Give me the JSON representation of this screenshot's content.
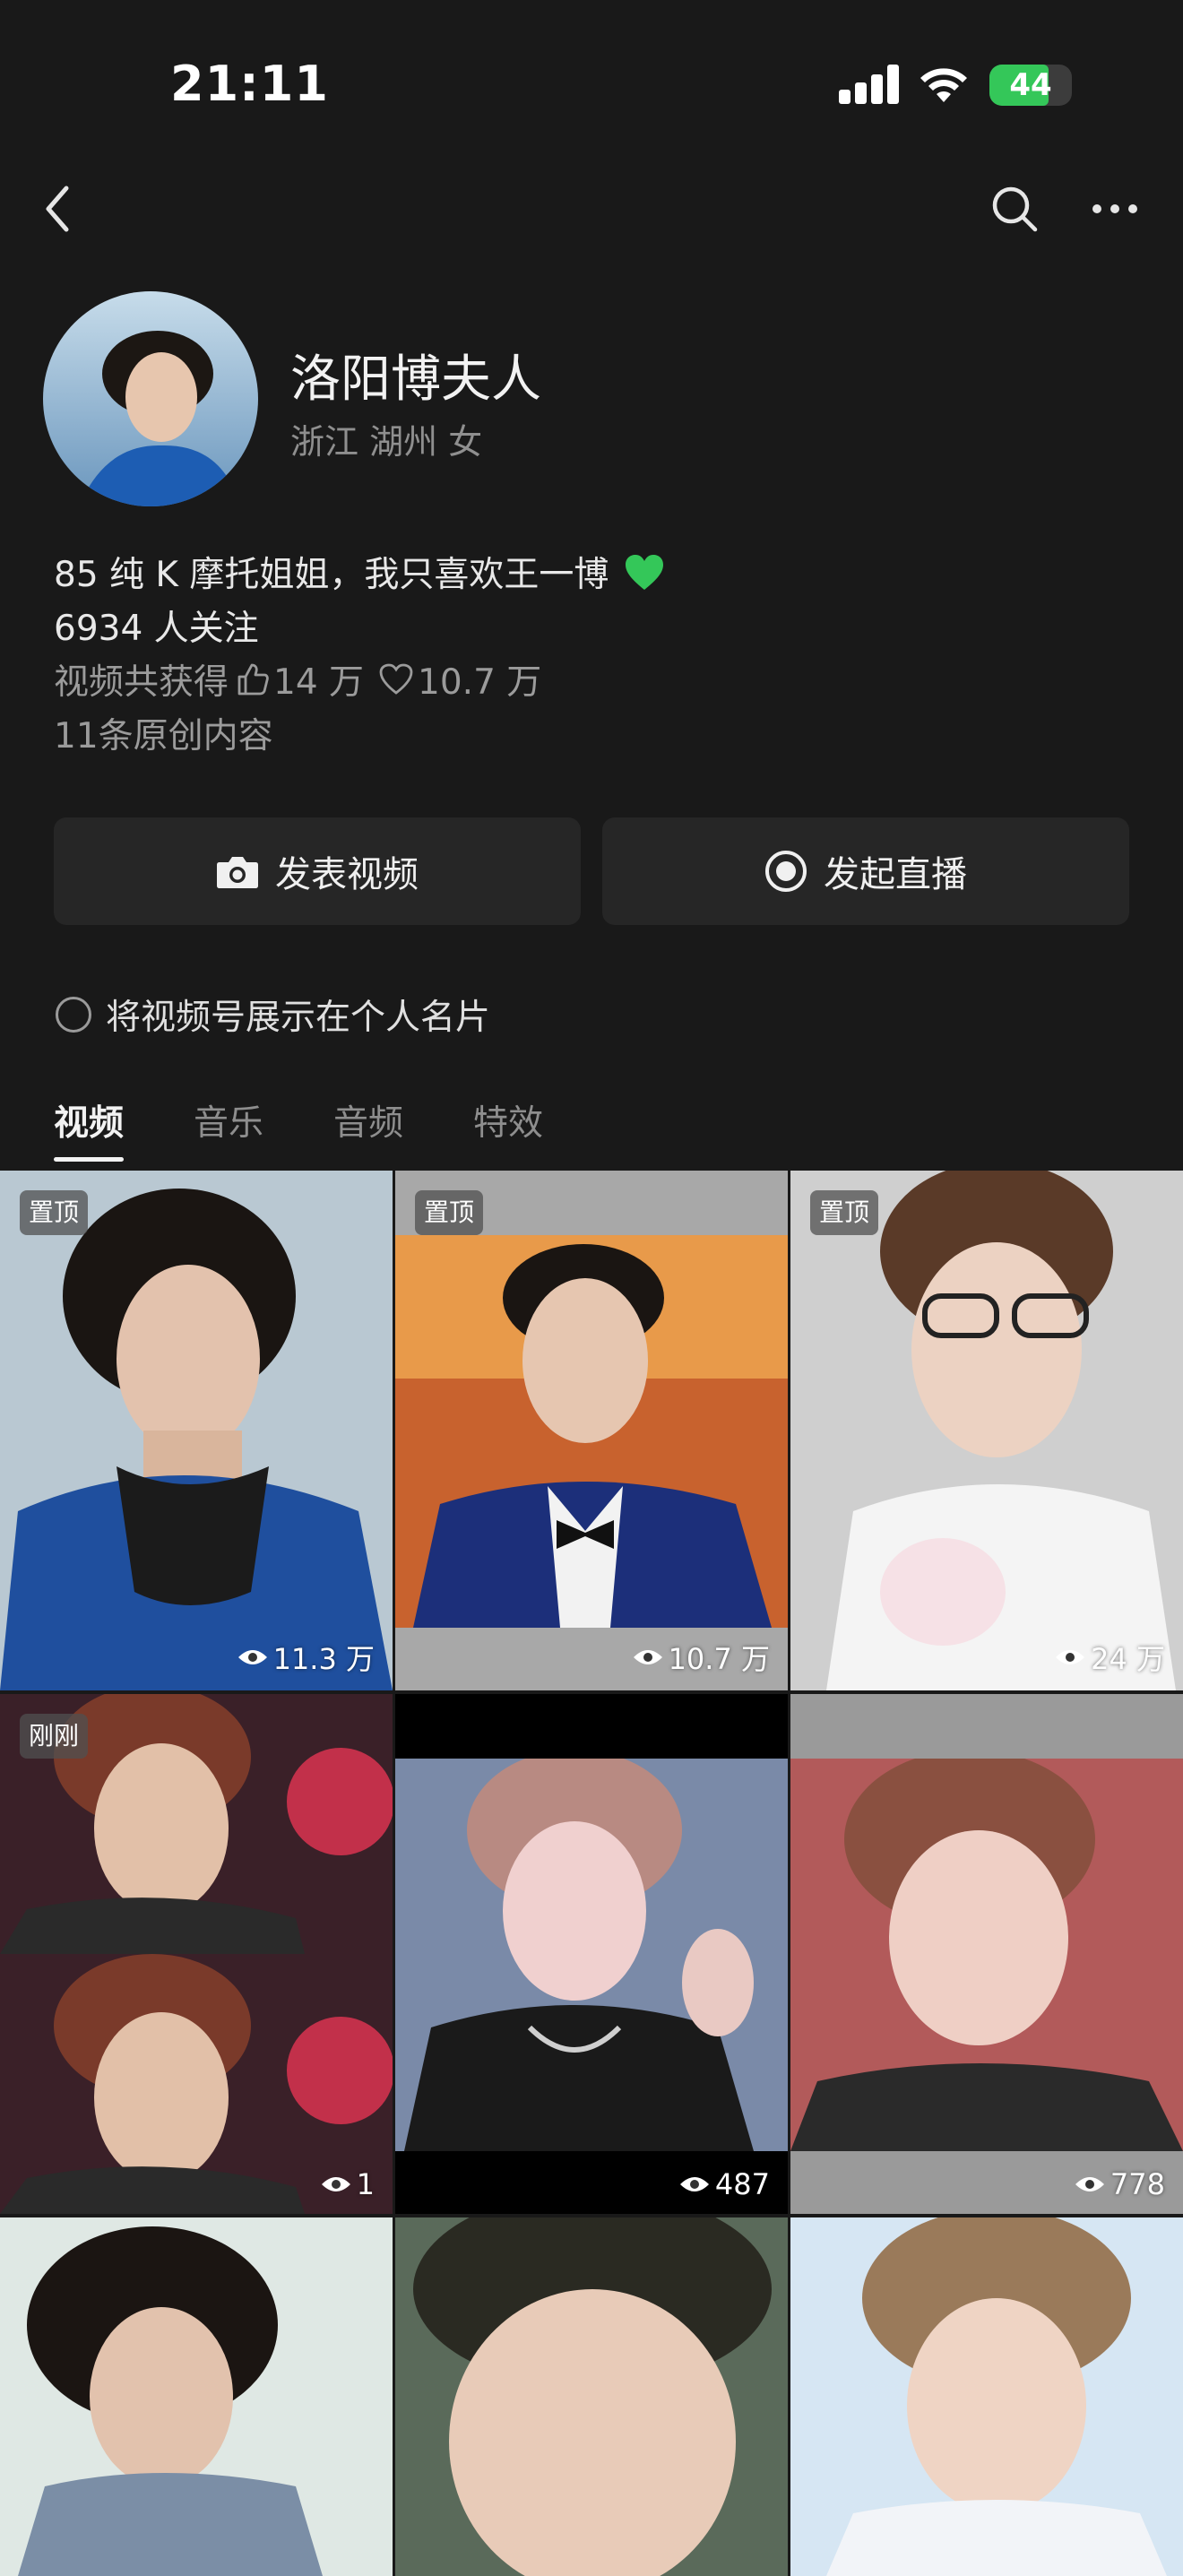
{
  "status": {
    "time": "21:11",
    "battery": "44"
  },
  "profile": {
    "name": "洛阳博夫人",
    "location": "浙江 湖州 女",
    "bio": "85 纯 K 摩托姐姐，我只喜欢王一博",
    "followers": "6934 人关注",
    "likes_prefix": "视频共获得",
    "likes_thumbs": "14 万",
    "likes_hearts": "10.7 万",
    "original_count": "11条原创内容"
  },
  "actions": {
    "post_video": "发表视频",
    "start_live": "发起直播"
  },
  "card_toggle": "将视频号展示在个人名片",
  "tabs": [
    "视频",
    "音乐",
    "音频",
    "特效"
  ],
  "videos": [
    {
      "badge": "置顶",
      "views": "11.3 万"
    },
    {
      "badge": "置顶",
      "views": "10.7 万"
    },
    {
      "badge": "置顶",
      "views": "24 万"
    },
    {
      "badge": "刚刚",
      "views": "1"
    },
    {
      "badge": "",
      "views": "487"
    },
    {
      "badge": "",
      "views": "778"
    },
    {
      "badge": "",
      "views": ""
    },
    {
      "badge": "",
      "views": ""
    },
    {
      "badge": "",
      "views": ""
    }
  ],
  "colors": {
    "background": "#191919",
    "button": "#262626",
    "battery": "#34c759",
    "heart": "#34c759"
  }
}
